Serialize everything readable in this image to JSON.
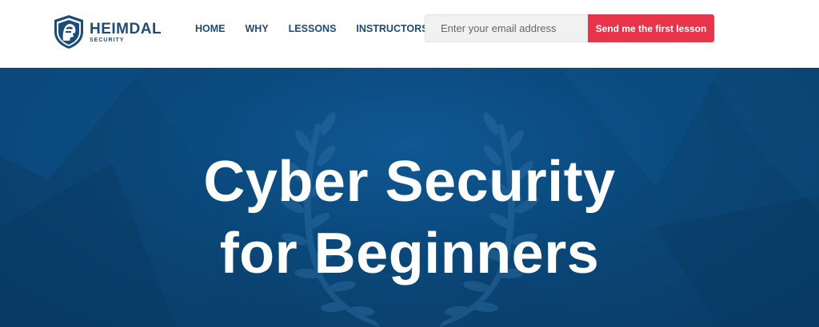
{
  "header": {
    "logo": {
      "brand": "HEIMDAL",
      "sub": "SECURITY",
      "icon": "shield-helmet-icon"
    },
    "nav": [
      {
        "label": "HOME"
      },
      {
        "label": "WHY"
      },
      {
        "label": "LESSONS"
      },
      {
        "label": "INSTRUCTORS"
      }
    ],
    "signup": {
      "placeholder": "Enter your email address",
      "value": "",
      "button_label": "Send me the first lesson"
    }
  },
  "hero": {
    "title_line1": "Cyber Security",
    "title_line2": "for Beginners",
    "decoration": "laurel-wreath-icon"
  },
  "colors": {
    "brand_blue": "#1d4c78",
    "nav_text": "#1e4a73",
    "cta_red": "#e8344b",
    "hero_bg": "#0a4779"
  }
}
